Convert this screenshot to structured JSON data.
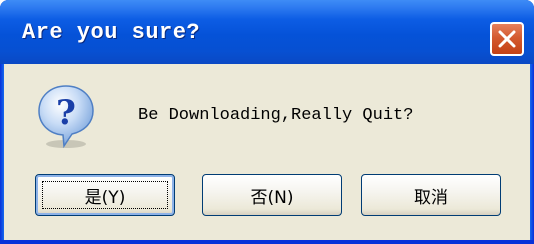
{
  "dialog": {
    "title": "Are you sure?",
    "message": "Be Downloading,Really Quit?",
    "icon": "question-icon",
    "close_icon": "close-icon"
  },
  "buttons": {
    "yes": "是(Y)",
    "no": "否(N)",
    "cancel": "取消"
  },
  "colors": {
    "titlebar": "#0552d8",
    "client": "#ece9d8",
    "close_button": "#d45a2f",
    "button_border": "#003c74"
  }
}
